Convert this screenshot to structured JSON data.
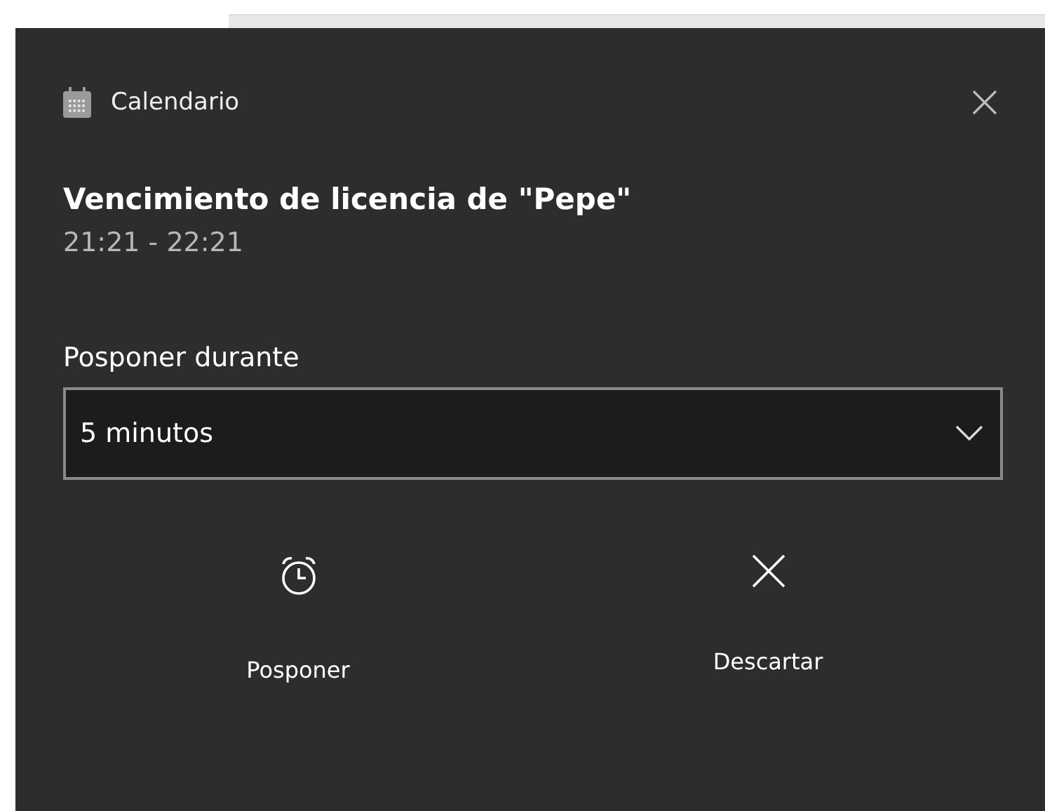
{
  "toast": {
    "app_name": "Calendario",
    "title": "Vencimiento de licencia de \"Pepe\"",
    "time": "21:21 - 22:21",
    "snooze_label": "Posponer durante",
    "snooze_select": {
      "value": "5 minutos"
    },
    "buttons": [
      {
        "kind": "snooze",
        "label": "Posponer"
      },
      {
        "kind": "dismiss",
        "label": "Descartar"
      }
    ]
  }
}
